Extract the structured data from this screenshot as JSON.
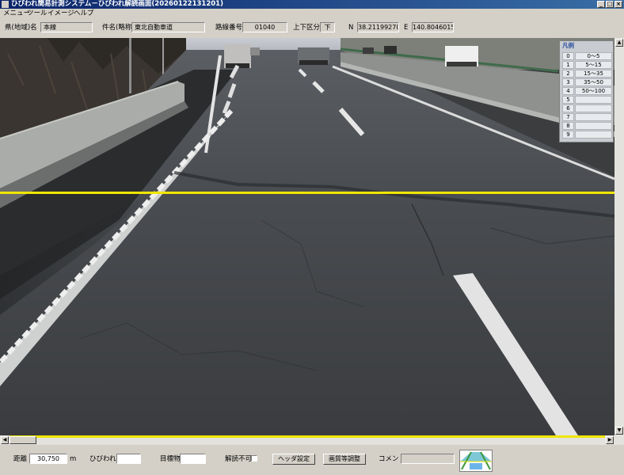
{
  "window": {
    "title": "ひびわれ簡易計測システム－ひびわれ解読画面(20260122131201)",
    "minimize_glyph": "_",
    "maximize_glyph": "□",
    "close_glyph": "×"
  },
  "menu": [
    "メニュー",
    "ツール",
    "イメージ",
    "ヘルプ"
  ],
  "header": {
    "prefecture_label": "県(地域)名",
    "prefecture_value": "本線",
    "case_label": "件名(略称)",
    "case_value": "東北自動車道",
    "route_label": "路線番号",
    "route_value": "01040",
    "direction_label": "上下区分",
    "direction_value": "下",
    "n_label": "N",
    "n_value": "38.21199270",
    "e_label": "E",
    "e_value": "140.8046015"
  },
  "legend": {
    "title": "凡例",
    "rows": [
      {
        "index": "0",
        "range": "0～5",
        "color": "#f0e600"
      },
      {
        "index": "1",
        "range": "5～15"
      },
      {
        "index": "2",
        "range": "15～35"
      },
      {
        "index": "3",
        "range": "35～50"
      },
      {
        "index": "4",
        "range": "50～100"
      },
      {
        "index": "5",
        "range": ""
      },
      {
        "index": "6",
        "range": ""
      },
      {
        "index": "7",
        "range": ""
      },
      {
        "index": "8",
        "range": ""
      },
      {
        "index": "9",
        "range": ""
      }
    ]
  },
  "scroll": {
    "up": "▲",
    "down": "▼",
    "left": "◀",
    "right": "▶"
  },
  "bottom": {
    "distance_label": "距離",
    "distance_value": "30,750",
    "distance_unit": "m",
    "crack_label": "ひびわれ",
    "crack_value": "",
    "landmark_label": "目標物",
    "landmark_value": "",
    "unreadable_label": "解読不可",
    "header_settings_button": "ヘッダ設定",
    "image_adjust_button": "画質等調整",
    "comment_label": "コメント",
    "comment_value": ""
  },
  "colors": {
    "titlebar": "#0a246a",
    "measure_line": "#f0e600",
    "window_bg": "#d4d0c8"
  }
}
